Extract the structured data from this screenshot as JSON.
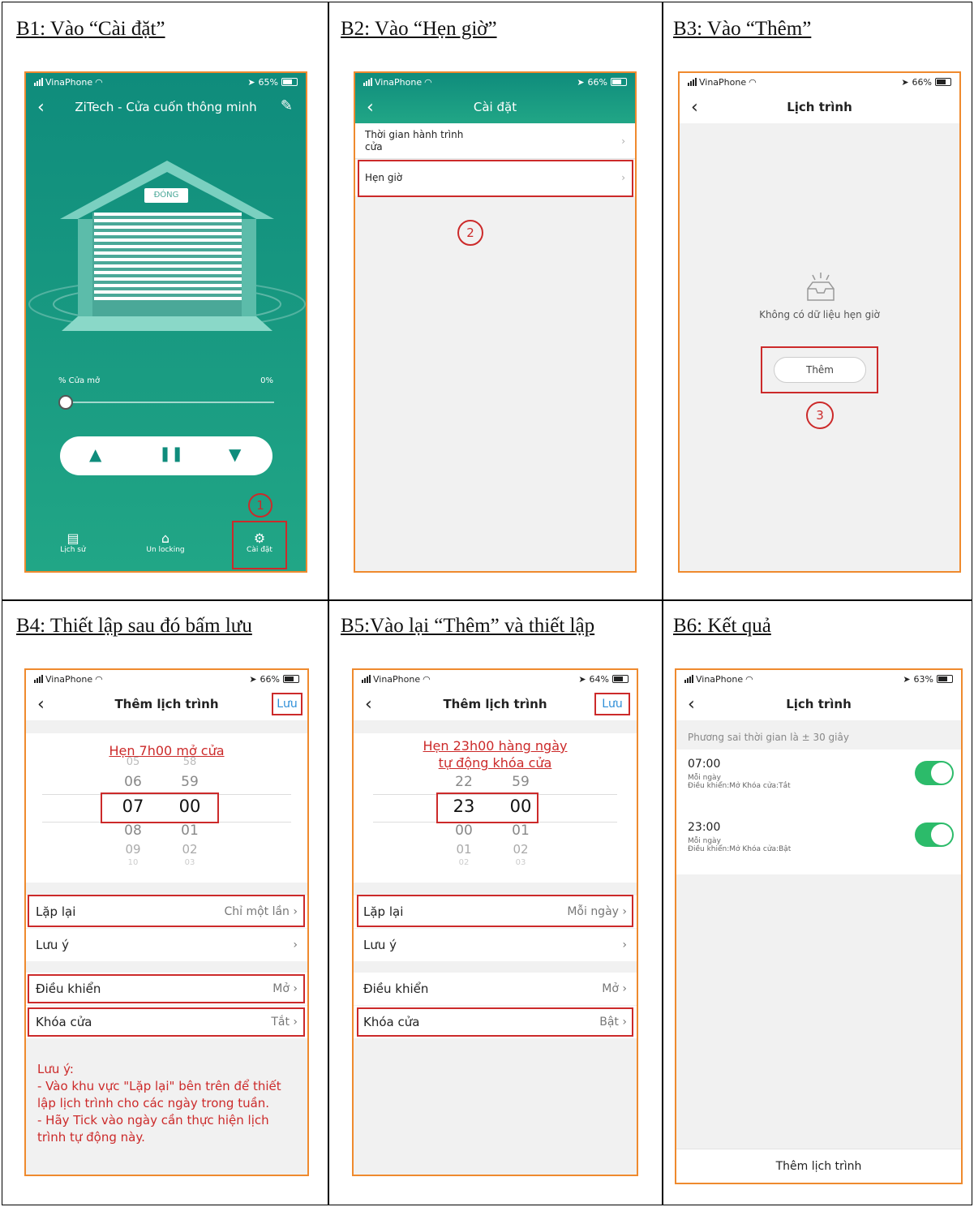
{
  "captions": {
    "b1": "B1: Vào “Cài đặt”",
    "b2": "B2: Vào “Hẹn giờ”",
    "b3": "B3: Vào “Thêm”",
    "b4": "B4: Thiết lập sau đó bấm lưu",
    "b5": "B5:Vào lại “Thêm” và thiết lập",
    "b6": "B6: Kết quả"
  },
  "status": {
    "carrier": "VinaPhone",
    "b1_batt": "65%",
    "b2_batt": "66%",
    "b3_batt": "66%",
    "b4_batt": "66%",
    "b5_batt": "64%",
    "b6_batt": "63%"
  },
  "b1": {
    "title": "ZiTech - Cửa cuốn thông minh",
    "door_label": "ĐÓNG",
    "open_label": "% Cửa mở",
    "open_value": "0%",
    "open_fraction": 0,
    "tabs": [
      "Lịch sử",
      "Un locking",
      "Cài đặt"
    ],
    "marker": "1"
  },
  "b2": {
    "title": "Cài đặt",
    "item1": "Thời gian hành trình cửa",
    "item2": "Hẹn giờ",
    "marker": "2"
  },
  "b3": {
    "title": "Lịch trình",
    "empty": "Không có dữ liệu hẹn giờ",
    "add": "Thêm",
    "marker": "3"
  },
  "b4": {
    "title": "Thêm lịch trình",
    "save": "Lưu",
    "annot": "Hẹn 7h00 mở cửa",
    "hours": [
      "05",
      "06",
      "07",
      "08",
      "09",
      "10"
    ],
    "mins": [
      "58",
      "59",
      "00",
      "01",
      "02",
      "03"
    ],
    "repeat": "Lặp lại",
    "repeat_v": "Chỉ một lần",
    "note": "Lưu ý",
    "control": "Điều khiển",
    "control_v": "Mở",
    "lock": "Khóa cửa",
    "lock_v": "Tắt",
    "notes": [
      "Lưu ý:",
      "- Vào khu vực \"Lặp lại\" bên trên để thiết",
      "lập lịch trình cho các ngày trong tuần.",
      "- Hãy Tick vào ngày cần thực hiện lịch",
      "trình tự động này."
    ]
  },
  "b5": {
    "title": "Thêm lịch trình",
    "save": "Lưu",
    "annot1": "Hẹn 23h00 hàng ngày",
    "annot2": "tự động khóa cửa",
    "hours": [
      "22",
      "23",
      "00",
      "01",
      "02"
    ],
    "mins": [
      "59",
      "00",
      "01",
      "02",
      "03"
    ],
    "repeat": "Lặp lại",
    "repeat_v": "Mỗi ngày",
    "note": "Lưu ý",
    "control": "Điều khiển",
    "control_v": "Mở",
    "lock": "Khóa cửa",
    "lock_v": "Bật"
  },
  "b6": {
    "title": "Lịch trình",
    "variance": "Phương sai thời gian là ± 30 giây",
    "items": [
      {
        "time": "07:00",
        "freq": "Mỗi ngày",
        "detail": "Điều khiển:Mở Khóa cửa:Tắt",
        "on": true
      },
      {
        "time": "23:00",
        "freq": "Mỗi ngày",
        "detail": "Điều khiển:Mở Khóa cửa:Bật",
        "on": true
      }
    ],
    "add": "Thêm lịch trình"
  },
  "colors": {
    "teal": "#1a9a82",
    "orange_border": "#ef8a2e",
    "annotation_red": "#cc2a2a",
    "toggle_green": "#2cbb6a"
  }
}
